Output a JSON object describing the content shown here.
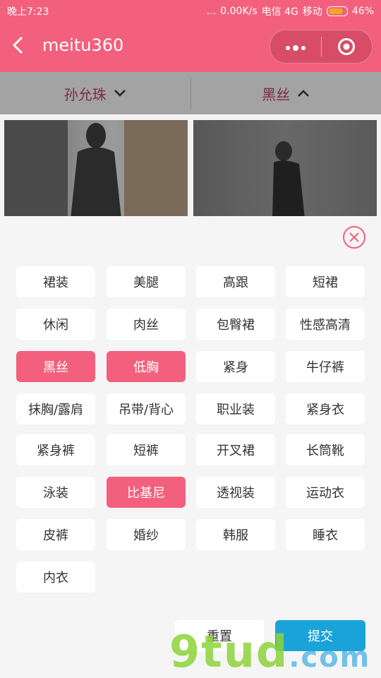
{
  "status_bar": {
    "time": "晚上7:23",
    "network_speed": "0.00K/s",
    "carrier1": "电信 4G",
    "carrier2": "移动",
    "battery": "46%",
    "dots": "..."
  },
  "header": {
    "back_icon": "chevron-left-icon",
    "title": "meitu360",
    "more_icon": "more-icon",
    "target_icon": "target-icon"
  },
  "filter_bar": {
    "left_label": "孙允珠",
    "right_label": "黑丝"
  },
  "thumbnails": {
    "count": 2
  },
  "tags": [
    {
      "label": "裙装",
      "selected": false
    },
    {
      "label": "美腿",
      "selected": false
    },
    {
      "label": "高跟",
      "selected": false
    },
    {
      "label": "短裙",
      "selected": false
    },
    {
      "label": "休闲",
      "selected": false
    },
    {
      "label": "肉丝",
      "selected": false
    },
    {
      "label": "包臀裙",
      "selected": false
    },
    {
      "label": "性感高清",
      "selected": false
    },
    {
      "label": "黑丝",
      "selected": true
    },
    {
      "label": "低胸",
      "selected": true
    },
    {
      "label": "紧身",
      "selected": false
    },
    {
      "label": "牛仔裤",
      "selected": false
    },
    {
      "label": "抹胸/露肩",
      "selected": false
    },
    {
      "label": "吊带/背心",
      "selected": false
    },
    {
      "label": "职业装",
      "selected": false
    },
    {
      "label": "紧身衣",
      "selected": false
    },
    {
      "label": "紧身裤",
      "selected": false
    },
    {
      "label": "短裤",
      "selected": false
    },
    {
      "label": "开叉裙",
      "selected": false
    },
    {
      "label": "长筒靴",
      "selected": false
    },
    {
      "label": "泳装",
      "selected": false
    },
    {
      "label": "比基尼",
      "selected": true
    },
    {
      "label": "透视装",
      "selected": false
    },
    {
      "label": "运动衣",
      "selected": false
    },
    {
      "label": "皮裤",
      "selected": false
    },
    {
      "label": "婚纱",
      "selected": false
    },
    {
      "label": "韩服",
      "selected": false
    },
    {
      "label": "睡衣",
      "selected": false
    },
    {
      "label": "内衣",
      "selected": false
    }
  ],
  "actions": {
    "reset": "重置",
    "submit": "提交"
  },
  "watermark": {
    "main": "9tud",
    "suffix": ".com"
  },
  "colors": {
    "brand": "#f2607d",
    "submit": "#1aa3d8"
  }
}
